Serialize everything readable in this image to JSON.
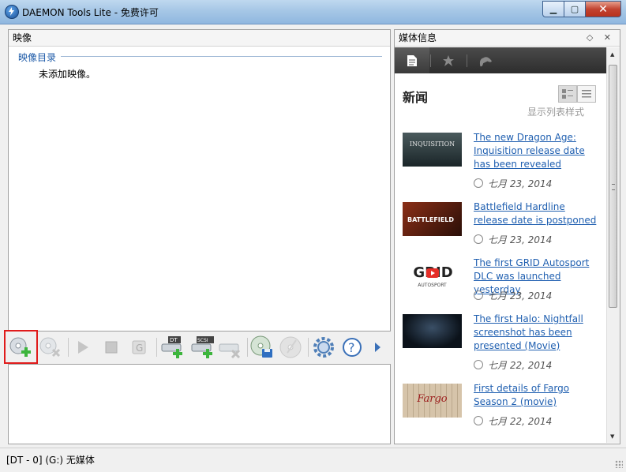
{
  "window": {
    "title": "DAEMON Tools Lite - 免费许可",
    "minimize": "▁",
    "maximize": "▢",
    "close": "✕"
  },
  "images_panel": {
    "header": "映像",
    "catalog_title": "映像目录",
    "empty_text": "未添加映像。"
  },
  "toolbar": {
    "items": [
      {
        "icon": "add-image-icon"
      },
      {
        "icon": "remove-image-icon"
      },
      {
        "icon": "play-icon"
      },
      {
        "icon": "stop-icon"
      },
      {
        "icon": "grabber-icon"
      },
      {
        "icon": "add-dt-drive-icon",
        "badge": "DT"
      },
      {
        "icon": "add-scsi-drive-icon",
        "badge": "SCSI"
      },
      {
        "icon": "remove-drive-icon"
      },
      {
        "icon": "make-image-icon"
      },
      {
        "icon": "burn-disc-icon"
      },
      {
        "icon": "settings-gear-icon"
      },
      {
        "icon": "help-icon",
        "label": "?"
      },
      {
        "icon": "more-arrow-icon"
      }
    ]
  },
  "media_panel": {
    "header": "媒体信息",
    "header_controls": "◇ ✕",
    "tabs": [
      {
        "icon": "document-icon",
        "active": true
      },
      {
        "icon": "star-icon",
        "active": false
      },
      {
        "icon": "gamepad-icon",
        "active": false
      }
    ],
    "news_title": "新闻",
    "list_style_label": "显示列表样式",
    "news": [
      {
        "title": "The new Dragon Age: Inquisition release date has been revealed",
        "date": "七月 23, 2014",
        "thumb_text": "INQUISITION",
        "thumb_color": "#2b3a3e"
      },
      {
        "title": "Battlefield Hardline release date is postponed",
        "date": "七月 23, 2014",
        "thumb_text": "BATTLEFIELD",
        "thumb_color": "#5a2a1a"
      },
      {
        "title": "The first GRID Autosport DLC was launched yesterday",
        "date": "七月 23, 2014",
        "thumb_text": "GRID",
        "thumb_sub": "AUTOSPORT",
        "thumb_color": "#ffffff"
      },
      {
        "title": "The first Halo: Nightfall screenshot has been presented (Movie)",
        "date": "七月 22, 2014",
        "thumb_text": "",
        "thumb_color": "#0e1620"
      },
      {
        "title": "First details of Fargo Season 2 (movie)",
        "date": "七月 22, 2014",
        "thumb_text": "Fargo",
        "thumb_color": "#c9b8a0"
      }
    ]
  },
  "status_bar": {
    "text": "[DT - 0] (G:) 无媒体"
  },
  "colors": {
    "accent_link": "#1f5fb0",
    "highlight_box": "#e01b1b",
    "close_button": "#c24431"
  }
}
